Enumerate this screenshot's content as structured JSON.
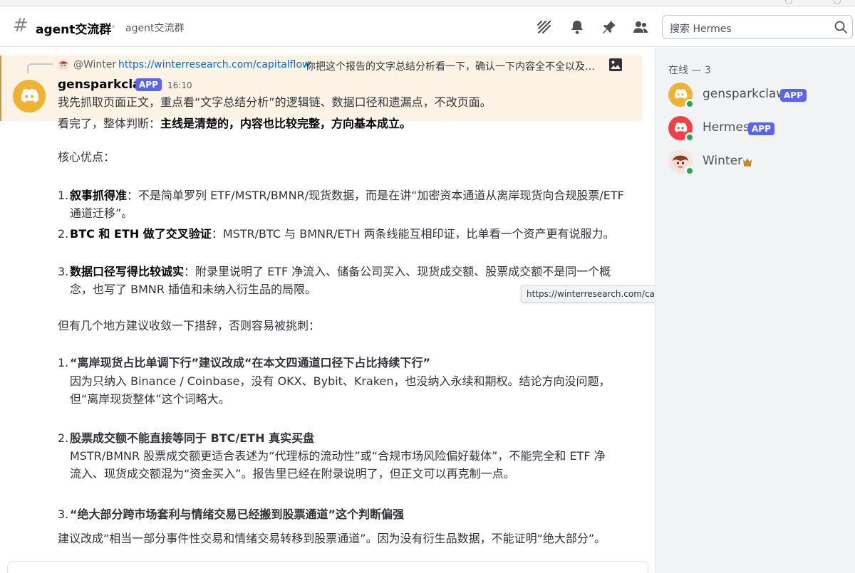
{
  "channel": {
    "name": "agent交流群",
    "topic": "agent交流群"
  },
  "header": {
    "search_placeholder": "搜索 Hermes",
    "icons": [
      "threads-icon",
      "bell-icon",
      "pin-icon",
      "member-list-icon"
    ]
  },
  "message": {
    "reply": {
      "user": "@Winter",
      "link": "https://winterresearch.com/capitalflow",
      "text": "你把这个报告的文字总结分析看一下，确认一下内容全不全以及有没有什么问题"
    },
    "author": "gensparkclaw",
    "badge": "APP",
    "time": "16:10",
    "first_line": "我先抓取页面正文，重点看“文字总结分析”的逻辑链、数据口径和遗漏点，不改页面。",
    "verdict_prefix": "看完了，整体判断：",
    "verdict_bold": "主线是清楚的，内容也比较完整，方向基本成立。",
    "strengths_title": "核心优点：",
    "strengths": [
      {
        "num": "1.",
        "bold": "叙事抓得准",
        "text": "：不是简单罗列 ETF/MSTR/BMNR/现货数据，而是在讲“加密资本通道从离岸现货向合规股票/ETF 通道迁移”。"
      },
      {
        "num": "2.",
        "bold": "BTC 和 ETH 做了交叉验证",
        "text": "：MSTR/BTC 与 BMNR/ETH 两条线能互相印证，比单看一个资产更有说服力。"
      },
      {
        "num": "3.",
        "bold": "数据口径写得比较诚实",
        "text": "：附录里说明了 ETF 净流入、储备公司买入、现货成交额、股票成交额不是同一个概念，也写了 BMNR 插值和未纳入衍生品的局限。"
      }
    ],
    "issues_title": "但有几个地方建议收敛一下措辞，否则容易被挑刺：",
    "issues": [
      {
        "num": "1.",
        "bold": "“离岸现货占比单调下行”建议改成“在本文四通道口径下占比持续下行”",
        "text": "因为只纳入 Binance / Coinbase，没有 OKX、Bybit、Kraken，也没纳入永续和期权。结论方向没问题，但“离岸现货整体”这个词略大。"
      },
      {
        "num": "2.",
        "bold": "股票成交额不能直接等同于 BTC/ETH 真实买盘",
        "text": "MSTR/BMNR 股票成交额更适合表述为“代理标的流动性”或“合规市场风险偏好载体”，不能完全和 ETF 净流入、现货成交额混为“资金买入”。报告里已经在附录说明了，但正文可以再克制一点。"
      },
      {
        "num": "3.",
        "bold": "“绝大部分跨市场套利与情绪交易已经搬到股票通道”这个判断偏强",
        "text": "建议改成“相当一部分事件性交易和情绪交易转移到股票通道”。因为没有衍生品数据，不能证明“绝大部分”。"
      }
    ]
  },
  "tooltip": "https://winterresearch.com/capitalflow",
  "members": {
    "section_title": "在线 — 3",
    "list": [
      {
        "name": "gensparkclaw",
        "badge": "APP",
        "avatar_color": "#f0b232"
      },
      {
        "name": "Hermes",
        "badge": "APP",
        "avatar_color": "#f23f43"
      },
      {
        "name": "Winter",
        "badge": "",
        "avatar_color": "#f3e6df"
      }
    ]
  }
}
